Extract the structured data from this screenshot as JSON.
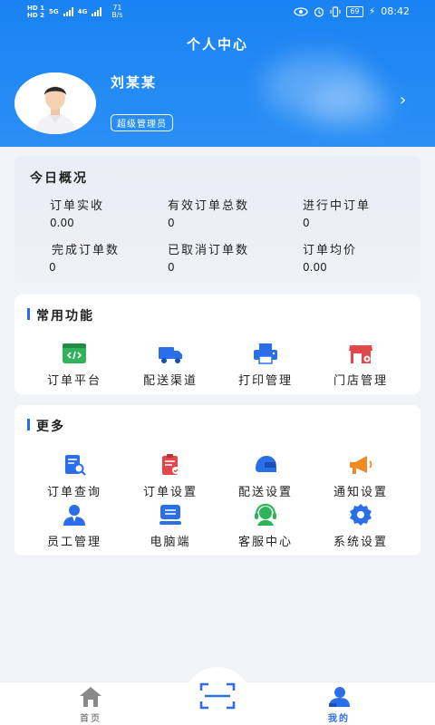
{
  "status_bar": {
    "sim1": "HD 1",
    "sim2": "HD 2",
    "net1": "5G",
    "net2": "4G",
    "speed_value": "71",
    "speed_unit": "B/s",
    "battery": "69",
    "time": "08:42"
  },
  "header": {
    "title": "个人中心",
    "user_name": "刘某某",
    "role": "超级管理员",
    "chevron": "›"
  },
  "overview": {
    "title": "今日概况",
    "stats": [
      {
        "label": "订单实收",
        "value": "0.00"
      },
      {
        "label": "有效订单总数",
        "value": "0"
      },
      {
        "label": "进行中订单",
        "value": "0"
      },
      {
        "label": "完成订单数",
        "value": "0"
      },
      {
        "label": "已取消订单数",
        "value": "0"
      },
      {
        "label": "订单均价",
        "value": "0.00"
      }
    ]
  },
  "common": {
    "title": "常用功能",
    "items": [
      {
        "label": "订单平台",
        "icon": "code-window-icon",
        "color": "#2fb35a"
      },
      {
        "label": "配送渠道",
        "icon": "truck-icon",
        "color": "#2b6fe8"
      },
      {
        "label": "打印管理",
        "icon": "printer-icon",
        "color": "#2b6fe8"
      },
      {
        "label": "门店管理",
        "icon": "store-icon",
        "color": "#e2474b"
      }
    ]
  },
  "more": {
    "title": "更多",
    "items": [
      {
        "label": "订单查询",
        "icon": "order-search-icon",
        "color": "#2b6fe8"
      },
      {
        "label": "订单设置",
        "icon": "order-settings-icon",
        "color": "#e2474b"
      },
      {
        "label": "配送设置",
        "icon": "helmet-icon",
        "color": "#2b6fe8"
      },
      {
        "label": "通知设置",
        "icon": "megaphone-icon",
        "color": "#f08a24"
      },
      {
        "label": "员工管理",
        "icon": "staff-icon",
        "color": "#2b6fe8"
      },
      {
        "label": "电脑端",
        "icon": "computer-icon",
        "color": "#2b6fe8"
      },
      {
        "label": "客服中心",
        "icon": "headset-icon",
        "color": "#2fb35a"
      },
      {
        "label": "系统设置",
        "icon": "gear-icon",
        "color": "#2b6fe8"
      }
    ]
  },
  "tabbar": {
    "home": "首页",
    "mine": "我的",
    "active_color": "#2b6fe8",
    "inactive_color": "#8a8a8a"
  }
}
